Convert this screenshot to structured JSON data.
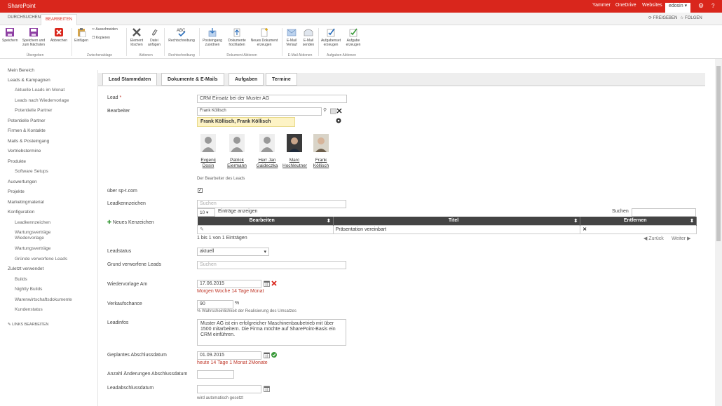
{
  "suite": {
    "brand": "SharePoint",
    "links": [
      "Yammer",
      "OneDrive",
      "Websites"
    ],
    "user": "edosin",
    "user_arrow": "▾",
    "gear": "⚙",
    "help": "?"
  },
  "ribbon": {
    "tabs": [
      "DURCHSUCHEN",
      "BEARBEITEN"
    ],
    "share": "FREIGEBEN",
    "follow": "FOLGEN",
    "buttons": {
      "save": "Speichern",
      "save_next": "Speichern und zum Nächsten",
      "cancel": "Abbrechen",
      "paste": "Einfügen",
      "cut": "Ausschneiden",
      "copy": "Kopieren",
      "delete_item": "Element löschen",
      "attach_file": "Datei anfügen",
      "spelling": "Rechtschreibung",
      "assign_inbox": "Posteingang zuordnen",
      "upload_docs": "Dokumente hochladen",
      "new_doc": "Neues Dokument erzeugen",
      "email_history": "E-Mail Verlauf",
      "send_email": "E-Mail senden",
      "create_taskset": "Aufgabenset erzeugen",
      "create_task": "Aufgabe erzeugen"
    },
    "groups": [
      "Übergeben",
      "Zwischenablage",
      "Aktionen",
      "Rechtschreibung",
      "Dokument Aktionen",
      "E-Mail Aktionen",
      "Aufgaben Aktionen"
    ]
  },
  "nav": {
    "items": [
      {
        "label": "Mein Bereich",
        "sub": false
      },
      {
        "label": "Leads & Kampagnen",
        "sub": false
      },
      {
        "label": "Aktuelle Leads im Monat",
        "sub": true
      },
      {
        "label": "Leads nach Wiedervorlage",
        "sub": true
      },
      {
        "label": "Potentielle Partner",
        "sub": true
      },
      {
        "label": "Potentielle Partner",
        "sub": false
      },
      {
        "label": "Firmen & Kontakte",
        "sub": false
      },
      {
        "label": "Mails & Posteingang",
        "sub": false
      },
      {
        "label": "Vertriebstermine",
        "sub": false
      },
      {
        "label": "Produkte",
        "sub": false
      },
      {
        "label": "Software Setups",
        "sub": true
      },
      {
        "label": "Auswertungen",
        "sub": false
      },
      {
        "label": "Projekte",
        "sub": false
      },
      {
        "label": "Marketingmaterial",
        "sub": false
      },
      {
        "label": "Konfiguration",
        "sub": false
      },
      {
        "label": "Leadkennzeichen",
        "sub": true
      },
      {
        "label": "Wartungsverträge Wiedervorlage",
        "sub": true
      },
      {
        "label": "Wartungsverträge",
        "sub": true
      },
      {
        "label": "Gründe verworfene Leads",
        "sub": true
      },
      {
        "label": "Zuletzt verwendet",
        "sub": false
      },
      {
        "label": "Builds",
        "sub": true
      },
      {
        "label": "Nightly Builds",
        "sub": true
      },
      {
        "label": "Warenwirtschaftsdokumente",
        "sub": true
      },
      {
        "label": "Kundenstatus",
        "sub": true
      }
    ],
    "edit_links": "LINKS BEARBEITEN"
  },
  "form": {
    "tabs": [
      "Lead Stammdaten",
      "Dokumente & E-Mails",
      "Aufgaben",
      "Termine"
    ],
    "lead_label": "Lead",
    "required_mark": "*",
    "lead_value": "CRM Einsatz bei der Muster AG",
    "owner_label": "Bearbeiter",
    "owner_input": "Frank Köllisch",
    "owner_suggestion": "Frank Köllisch, Frank Köllisch",
    "people": [
      {
        "first": "Evgenij",
        "last": "Dosin"
      },
      {
        "first": "Patrick",
        "last": "Eiermann"
      },
      {
        "first": "Herr Jan",
        "last": "Gaideczka"
      },
      {
        "first": "Marc",
        "last": "Hochleutner"
      },
      {
        "first": "Frank",
        "last": "Köllisch"
      }
    ],
    "owner_hint": "Der Bearbeiter des Leads",
    "via_label": "über sp-t.com",
    "via_checked": true,
    "tag_label": "Leadkennzeichen",
    "search_placeholder": "Suchen",
    "page_size": "10",
    "page_size_suffix": "Einträge anzeigen",
    "search_label": "Suchen",
    "new_tag": "Neues Kenzeichen",
    "table": {
      "headers": [
        "Bearbeiten",
        "Titel",
        "Entfernen"
      ],
      "rows": [
        {
          "title": "Präsentation vereinbart",
          "remove": "✕"
        }
      ]
    },
    "table_info": "1 bis 1 von 1 Einträgen",
    "prev": "Zurück",
    "next": "Weiter",
    "status_label": "Leadstatus",
    "status_value": "aktuell",
    "discard_label": "Grund verworfene Leads",
    "followup_label": "Wiedervorlage Am",
    "followup_value": "17.06.2015",
    "followup_links": "Morgen Woche 14 Tage Monat",
    "chance_label": "Verkaufschance",
    "chance_value": "90",
    "chance_unit": "%",
    "chance_hint": "% Wahrscheinlichkeit der Realisierung des Umsatzes",
    "info_label": "Leadinfos",
    "info_value": "Muster AG ist ein erfolgreicher Maschinenbaubetrieb mit über 1500 mitarbeitern. Die Firma möchte auf SharePoint-Basis ein CRM einführen.",
    "planned_label": "Geplantes Abschlussdatum",
    "planned_value": "01.09.2015",
    "planned_links": "heute 14 Tage 1 Monat 2Monate",
    "changes_label": "Anzahl Änderungen Abschlussdatum",
    "close_label": "Leadabschlussdatum",
    "close_hint": "wird automatisch gesetzt"
  },
  "colors": {
    "brand": "#d9261c",
    "accent": "#2a6ebb"
  }
}
